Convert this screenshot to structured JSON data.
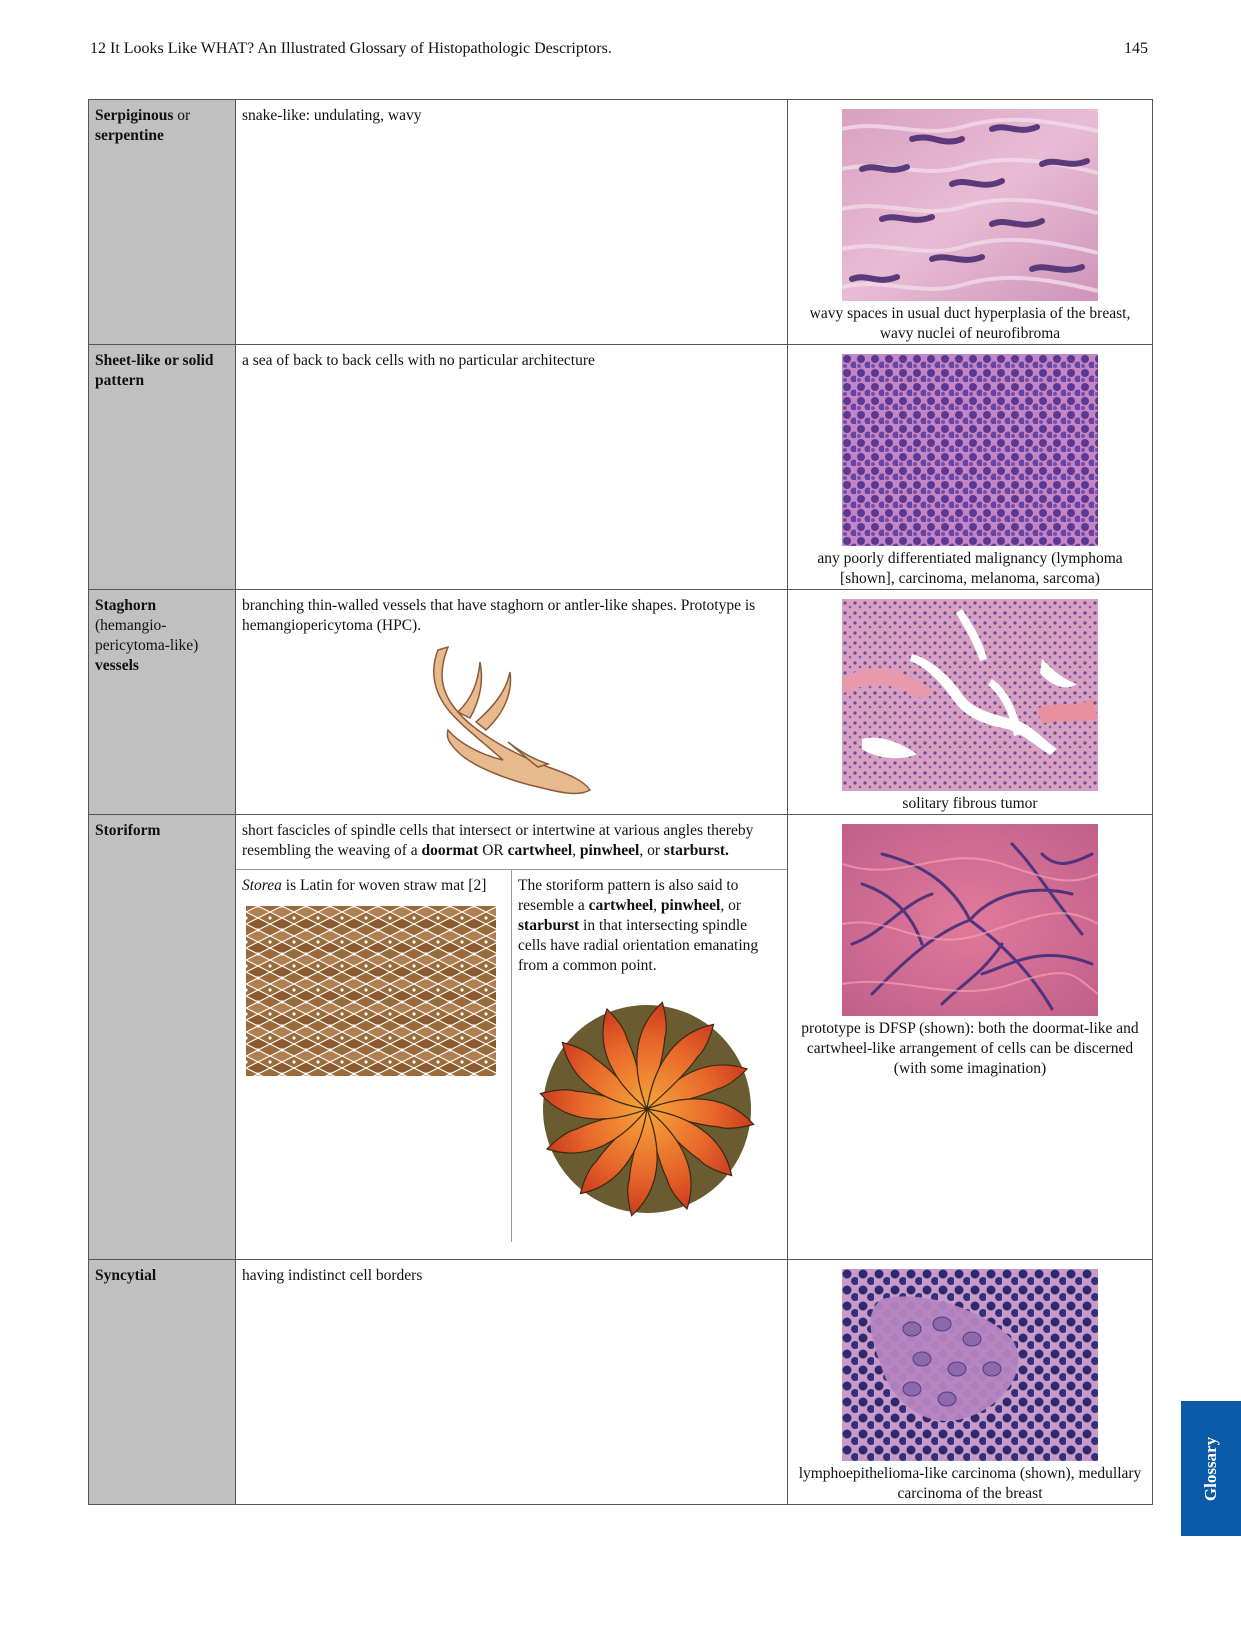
{
  "header": {
    "title": "12  It Looks Like WHAT? An Illustrated Glossary of Histopathologic Descriptors.",
    "page_number": "145"
  },
  "rows": [
    {
      "term_bold": "Serpiginous",
      "term_rest": " or",
      "term_line2": "serpentine",
      "definition": "snake-like: undulating, wavy",
      "caption": "wavy spaces in usual duct hyperplasia of the breast, wavy nuclei of neurofibroma"
    },
    {
      "term_bold": "Sheet-like or solid pattern",
      "definition": "a sea of back to back cells with no particular architecture",
      "caption": "any poorly differentiated malignancy (lymphoma [shown], carcinoma, melanoma, sarcoma)"
    },
    {
      "term_bold": "Staghorn",
      "term_mid": "(hemangio-pericytoma-like)",
      "term_end": "vessels",
      "definition": "branching thin-walled vessels that have staghorn or antler-like shapes. Prototype is hemangiopericytoma (HPC).",
      "caption": "solitary fibrous tumor"
    },
    {
      "term_bold": "Storiform",
      "def_p1": "short fascicles of spindle cells that intersect or intertwine at various angles thereby resembling the weaving of a ",
      "def_b1": "doormat",
      "def_p2": " OR ",
      "def_b2": "cartwheel",
      "def_p3": ", ",
      "def_b3": "pinwheel",
      "def_p4": ", or ",
      "def_b4": "starburst.",
      "sub_left_italic": "Storea",
      "sub_left_rest": " is Latin for woven straw mat [2]",
      "sub_right_p1": "The storiform pattern is also said to resemble a ",
      "sub_right_b1": "cartwheel",
      "sub_right_p2": ", ",
      "sub_right_b2": "pinwheel",
      "sub_right_p3": ", or ",
      "sub_right_b3": "starburst",
      "sub_right_p4": " in that intersecting spindle cells have radial orientation emanating from a common point.",
      "caption": "prototype is DFSP (shown): both the doormat-like and cartwheel-like arrangement of cells can be discerned (with some imagination)"
    },
    {
      "term_bold": "Syncytial",
      "definition": "having indistinct cell borders",
      "caption": "lymphoepithelioma-like carcinoma (shown), medullary carcinoma of the breast"
    }
  ],
  "side_tab": "Glossary",
  "colors": {
    "term_bg": "#c0c0c0",
    "tab_blue": "#0b5aa8",
    "he_pink": "#e3a6c4",
    "he_purple": "#5a3a8a",
    "antler": "#e8b98c",
    "mat_brown": "#9a6a3a",
    "pinwheel_red": "#c9381e",
    "pinwheel_orange": "#f5a63c"
  }
}
